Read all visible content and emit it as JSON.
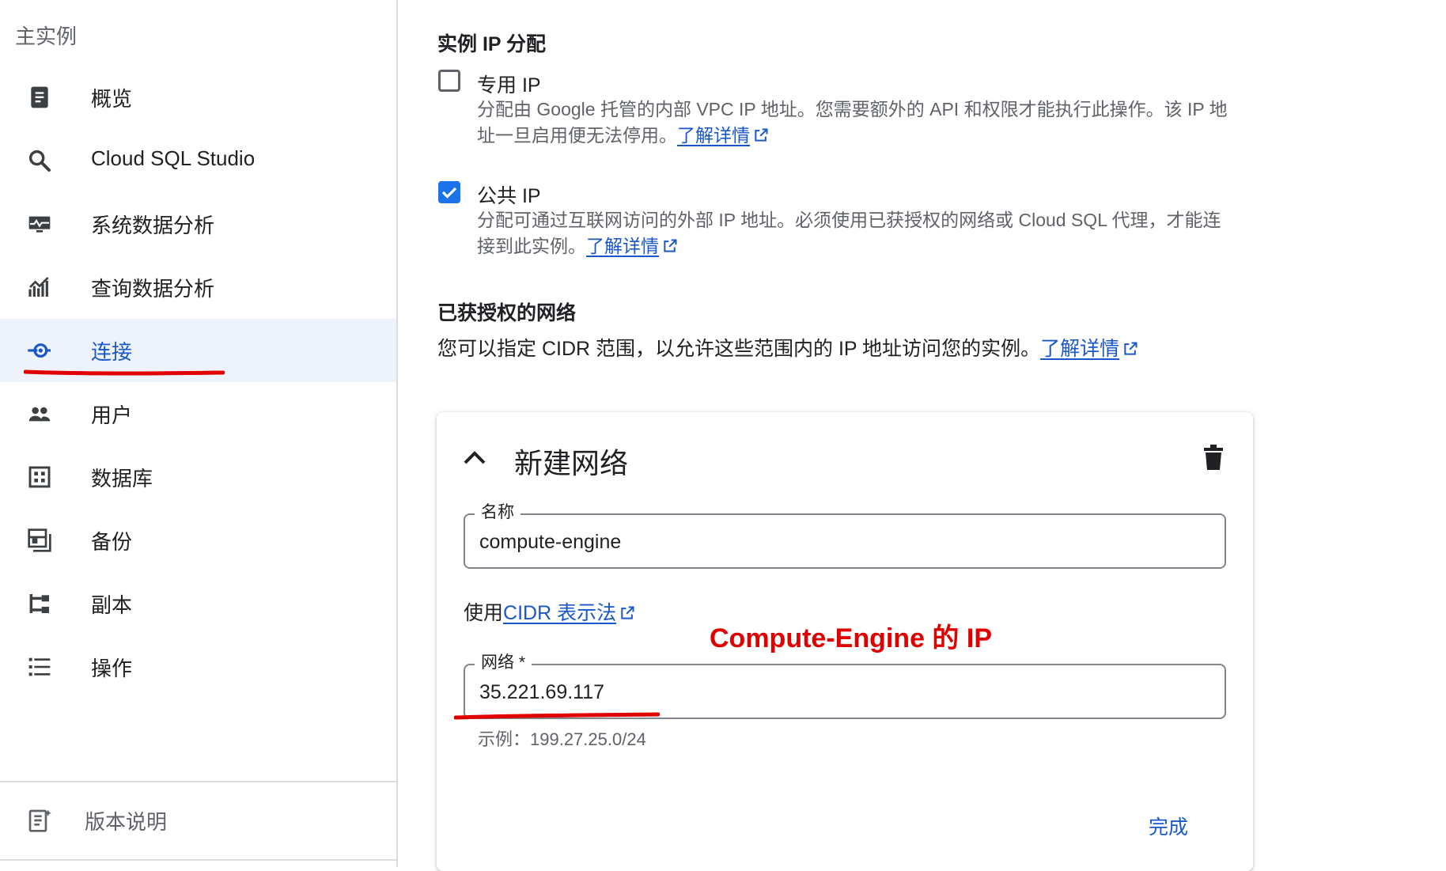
{
  "sidebar": {
    "title": "主实例",
    "items": [
      {
        "label": "概览",
        "icon": "document-icon"
      },
      {
        "label": "Cloud SQL Studio",
        "icon": "search-icon"
      },
      {
        "label": "系统数据分析",
        "icon": "monitor-pulse-icon"
      },
      {
        "label": "查询数据分析",
        "icon": "chart-icon"
      },
      {
        "label": "连接",
        "icon": "connect-icon",
        "active": true
      },
      {
        "label": "用户",
        "icon": "people-icon"
      },
      {
        "label": "数据库",
        "icon": "database-grid-icon"
      },
      {
        "label": "备份",
        "icon": "backup-icon"
      },
      {
        "label": "副本",
        "icon": "replica-icon"
      },
      {
        "label": "操作",
        "icon": "list-icon"
      }
    ],
    "release_notes": "版本说明"
  },
  "main": {
    "ip_section_title": "实例 IP 分配",
    "private_ip": {
      "label": "专用 IP",
      "checked": false,
      "help_line1": "分配由 Google 托管的内部 VPC IP 地址。您需要额外的 API 和权限才能执行此操作。该 IP 地",
      "help_line2": "址一旦启用便无法停用。",
      "link": "了解详情"
    },
    "public_ip": {
      "label": "公共 IP",
      "checked": true,
      "help_line1": "分配可通过互联网访问的外部 IP 地址。必须使用已获授权的网络或 Cloud SQL 代理，才能连",
      "help_line2": "接到此实例。",
      "link": "了解详情"
    },
    "authorized_title": "已获授权的网络",
    "authorized_desc": "您可以指定 CIDR 范围，以允许这些范围内的 IP 地址访问您的实例。",
    "authorized_link": "了解详情",
    "card": {
      "title": "新建网络",
      "name_label": "名称",
      "name_value": "compute-engine",
      "cidr_prefix": "使用",
      "cidr_link": "CIDR 表示法",
      "annotation": "Compute-Engine 的 IP",
      "network_label": "网络 *",
      "network_value": "35.221.69.117",
      "example": "示例：199.27.25.0/24",
      "done": "完成"
    }
  },
  "colors": {
    "accent": "#1a73e8",
    "link": "#1a57c9",
    "annotation_red": "#e00000",
    "active_bg": "#edf2fb"
  }
}
